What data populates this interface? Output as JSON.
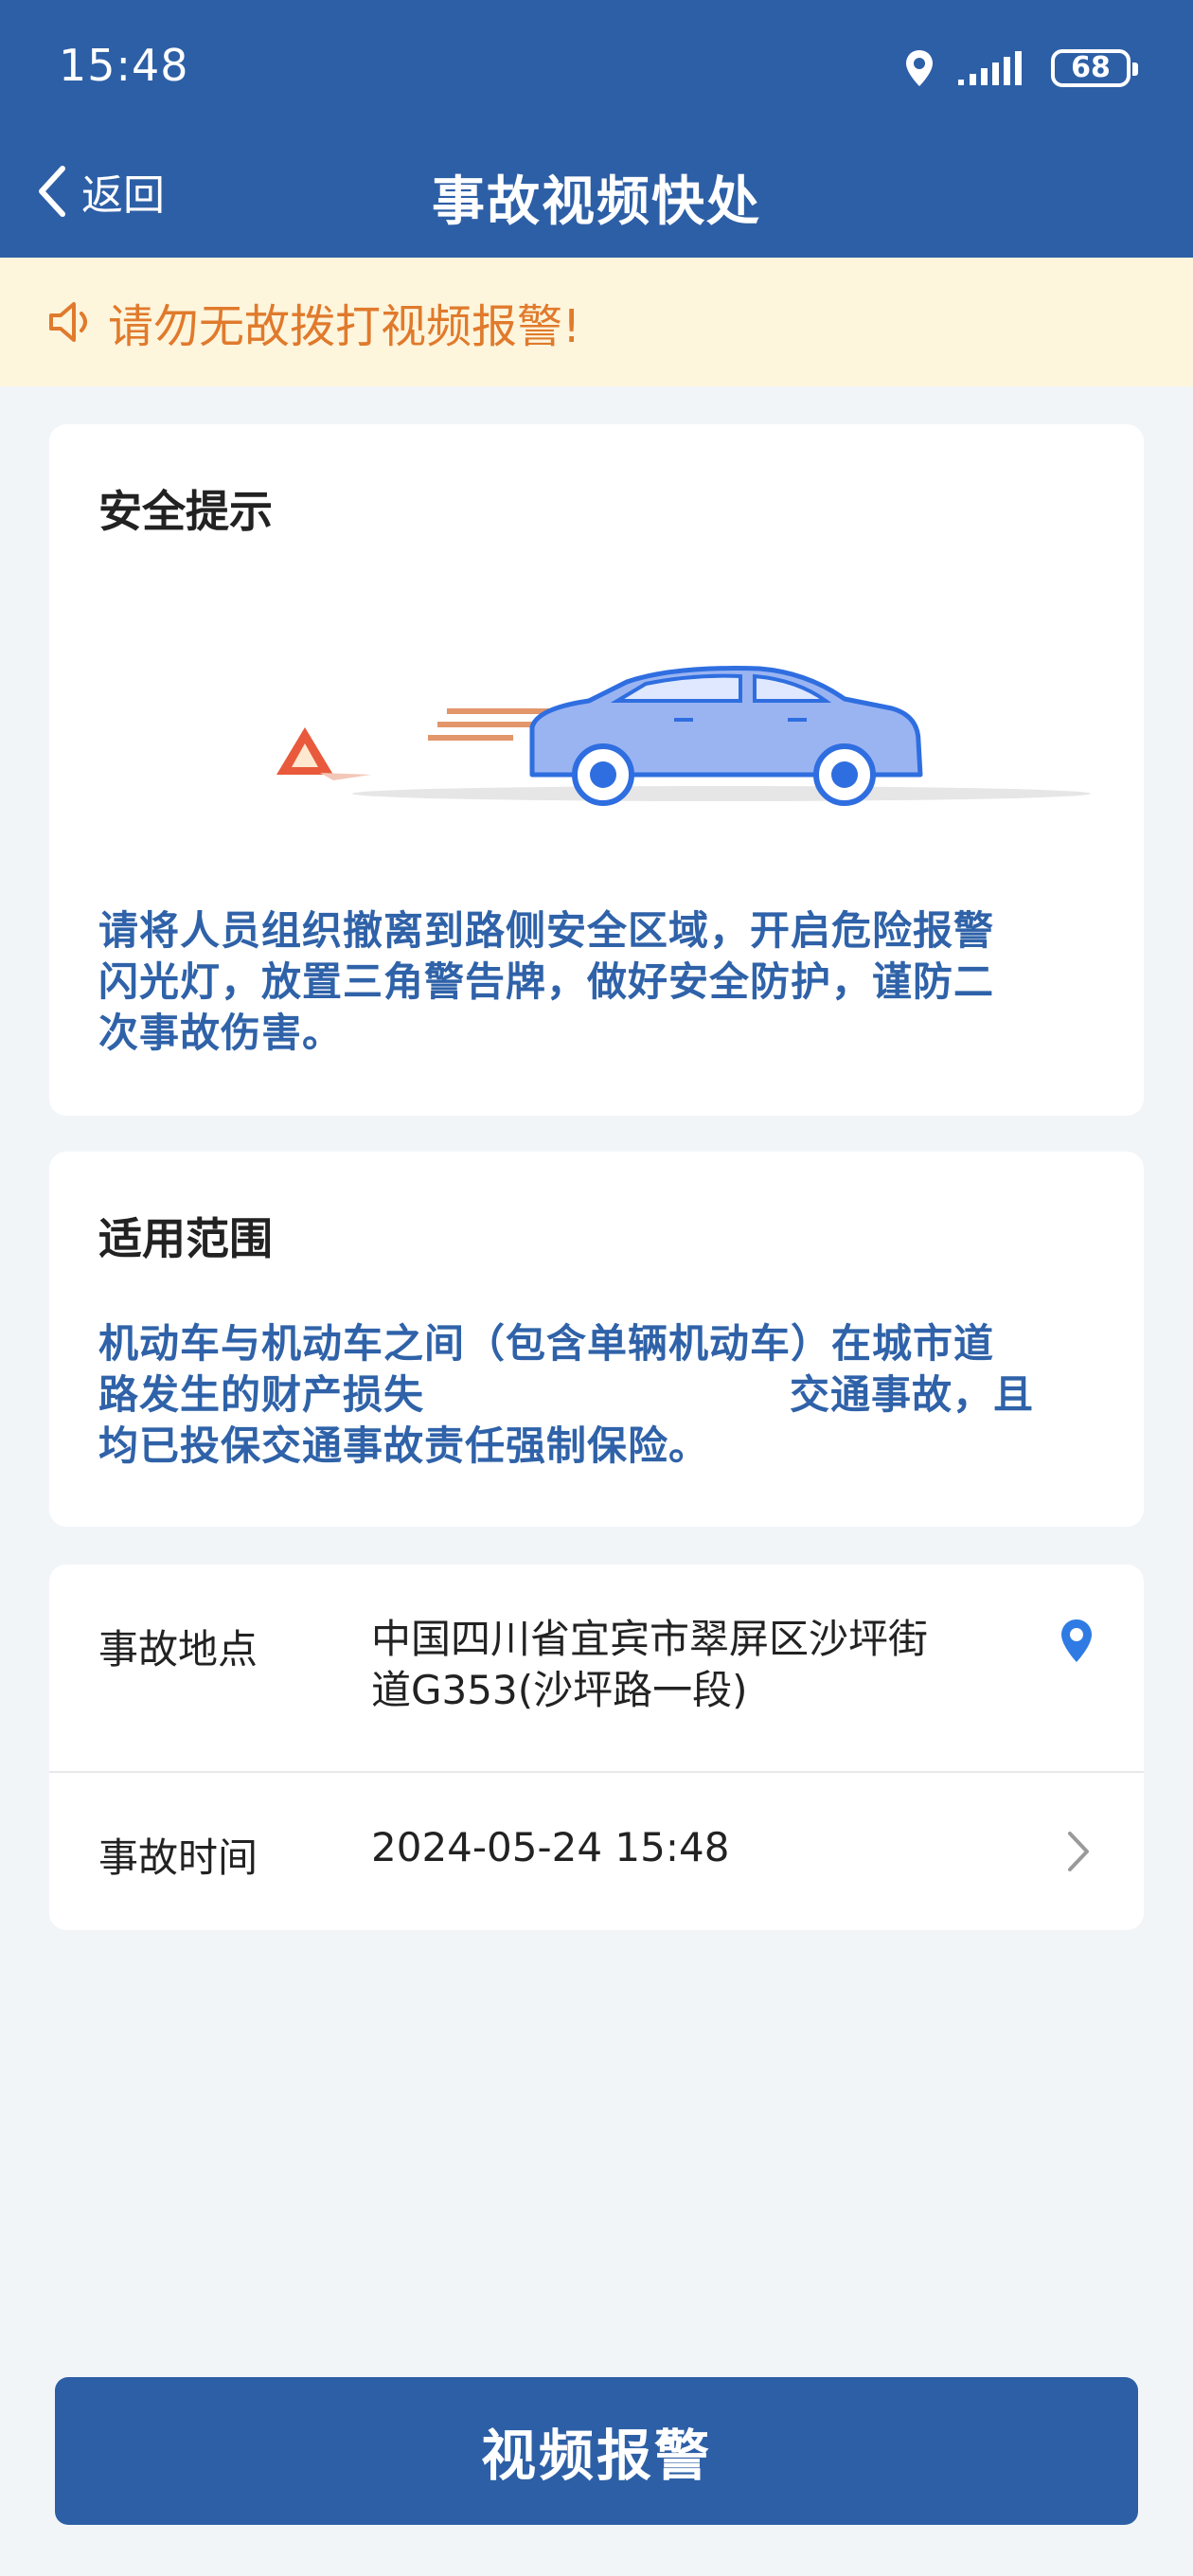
{
  "status_bar": {
    "time": "15:48",
    "battery": "68"
  },
  "nav": {
    "back_label": "返回",
    "title": "事故视频快处"
  },
  "notice": {
    "text": "请勿无故拨打视频报警!"
  },
  "safety_card": {
    "title": "安全提示",
    "lines": [
      "请将人员组织撤离到路侧安全区域，开启危险报警",
      "闪光灯，放置三角警告牌，做好安全防护，谨防二",
      "次事故伤害。"
    ]
  },
  "scope_card": {
    "title": "适用范围",
    "lines": [
      "机动车与机动车之间（包含单辆机动车）在城市道",
      "路发生的财产损失",
      "交通事故，且",
      "均已投保交通事故责任强制保险。"
    ]
  },
  "form": {
    "location_label": "事故地点",
    "location_value_line1": "中国四川省宜宾市翠屏区沙坪街",
    "location_value_line2": "道G353(沙坪路一段)",
    "time_label": "事故时间",
    "time_value": "2024-05-24 15:48"
  },
  "submit_label": "视频报警",
  "colors": {
    "brand": "#2d5fa6",
    "notice_bg": "#fdf5dc",
    "notice_text": "#e07a2c",
    "body_blue": "#2f62a8"
  }
}
